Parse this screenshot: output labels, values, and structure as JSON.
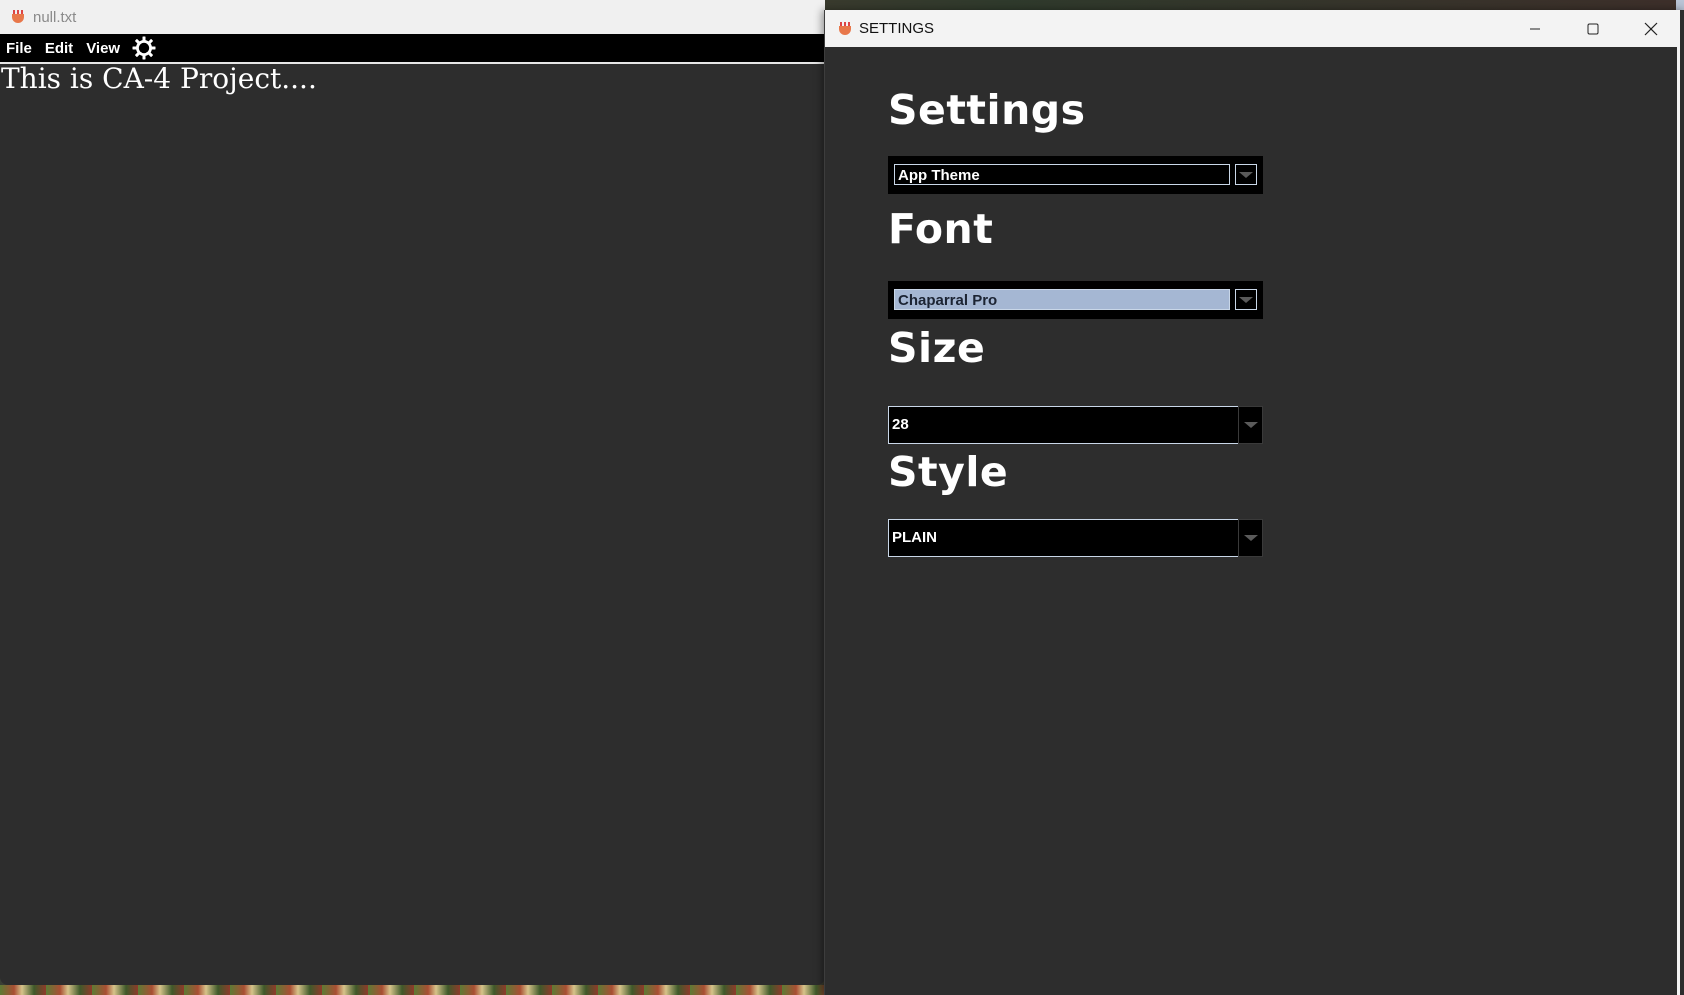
{
  "editor": {
    "title": "null.txt",
    "menu": [
      "File",
      "Edit",
      "View"
    ],
    "settings_icon": "gear-icon",
    "text": "This is CA-4 Project...."
  },
  "settings_window": {
    "title": "SETTINGS",
    "controls": [
      "minimize-icon",
      "maximize-icon",
      "close-icon"
    ],
    "sections": {
      "settings": {
        "heading": "Settings",
        "value": "App Theme"
      },
      "font": {
        "heading": "Font",
        "value": "Chaparral Pro"
      },
      "size": {
        "heading": "Size",
        "value": "28"
      },
      "style": {
        "heading": "Style",
        "value": "PLAIN"
      }
    }
  },
  "colors": {
    "window_bg": "#2d2d2d",
    "menubar_bg": "#000000",
    "selected_field": "#a5b7d3",
    "field_border": "#c9d7e8"
  }
}
